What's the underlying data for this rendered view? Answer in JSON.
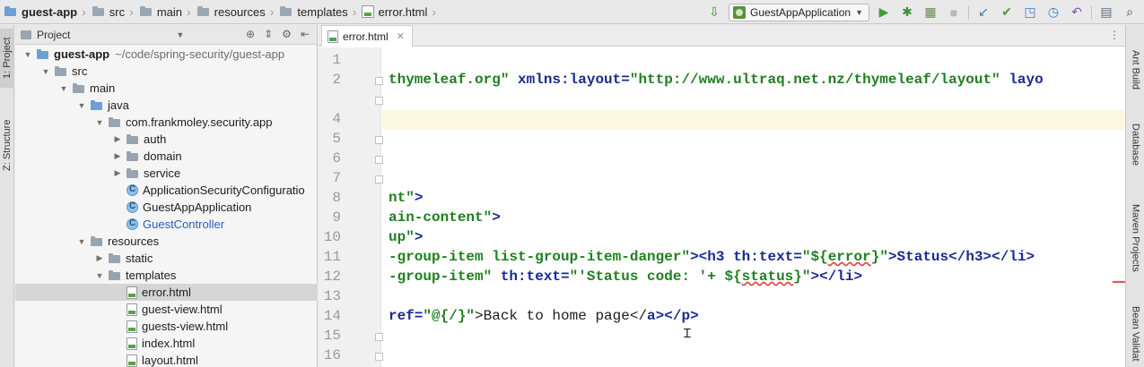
{
  "breadcrumbs": [
    "guest-app",
    "src",
    "main",
    "resources",
    "templates",
    "error.html"
  ],
  "run_config": "GuestAppApplication",
  "left_tabs": {
    "project": "1: Project",
    "structure": "Z: Structure"
  },
  "right_tabs": {
    "ant": "Ant Build",
    "database": "Database",
    "maven": "Maven Projects",
    "bean": "Bean Validat"
  },
  "project_panel": {
    "title": "Project"
  },
  "tree": [
    {
      "label": "guest-app",
      "path": "~/code/spring-security/guest-app"
    },
    {
      "label": "src"
    },
    {
      "label": "main"
    },
    {
      "label": "java"
    },
    {
      "label": "com.frankmoley.security.app"
    },
    {
      "label": "auth"
    },
    {
      "label": "domain"
    },
    {
      "label": "service"
    },
    {
      "label": "ApplicationSecurityConfiguratio"
    },
    {
      "label": "GuestAppApplication"
    },
    {
      "label": "GuestController"
    },
    {
      "label": "resources"
    },
    {
      "label": "static"
    },
    {
      "label": "templates"
    },
    {
      "label": "error.html"
    },
    {
      "label": "guest-view.html"
    },
    {
      "label": "guests-view.html"
    },
    {
      "label": "index.html"
    },
    {
      "label": "layout.html"
    }
  ],
  "editor": {
    "tab_label": "error.html",
    "line_numbers": [
      "1",
      "2",
      "4",
      "5",
      "6",
      "7",
      "8",
      "9",
      "10",
      "11",
      "12",
      "13",
      "14",
      "15",
      "16"
    ],
    "lines": [
      [
        "",
        ""
      ],
      [
        "thymeleaf.org\"",
        " xmlns:layout=",
        "\"http://www.ultraq.net.nz/thymeleaf/layout\"",
        " layo"
      ],
      [
        "nt\"",
        ">"
      ],
      [
        "ain-content\"",
        ">"
      ],
      [
        "up\"",
        ">"
      ],
      [
        "-group-item list-group-item-danger\"",
        "><",
        "h3 th:text=",
        "\"${",
        "error",
        "}\"",
        ">Status</h3></li>"
      ],
      [
        "-group-item\"",
        " th:text=",
        "\"'Status code: '+ ${",
        "status",
        "}\"",
        "></li>"
      ],
      [
        "ref=",
        "\"@{/}\"",
        ">Back to home page</",
        "a",
        "></p>"
      ]
    ]
  },
  "colors": {
    "tag": "#1a2a8f",
    "string": "#1f7f1f",
    "current_line": "#fcf8e0",
    "error": "#e23a3a"
  }
}
